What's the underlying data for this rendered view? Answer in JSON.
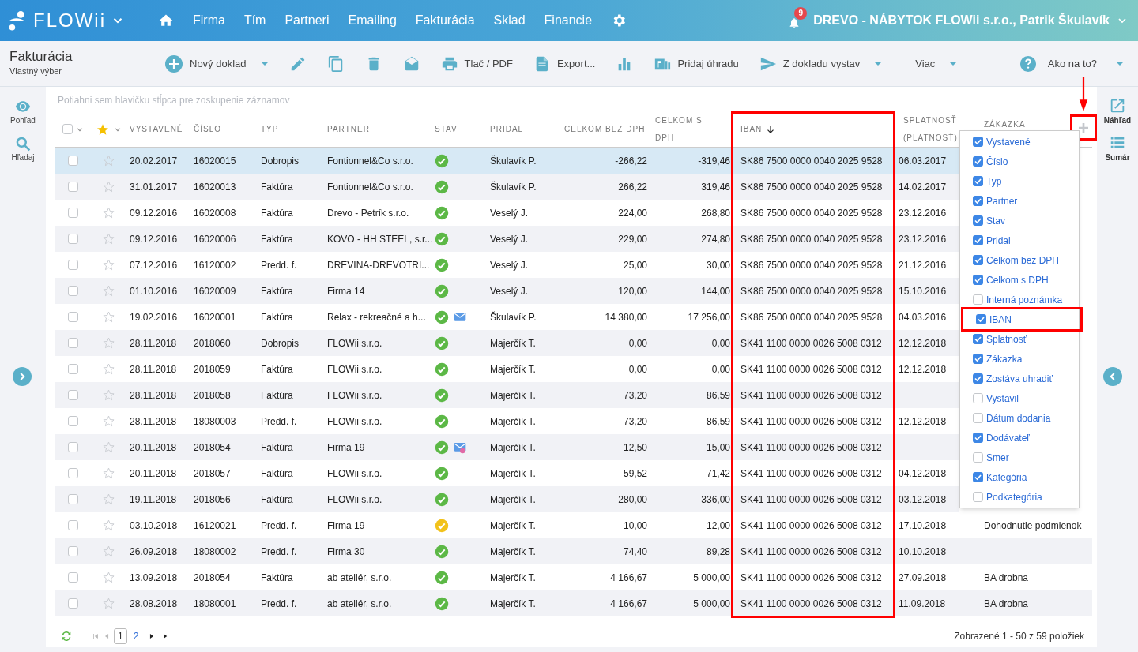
{
  "brand": {
    "name": "FLOWii"
  },
  "nav": [
    "Firma",
    "Tím",
    "Partneri",
    "Emailing",
    "Fakturácia",
    "Sklad",
    "Financie"
  ],
  "notifications": "9",
  "account": "DREVO - NÁBYTOK FLOWii s.r.o., Patrik Škulavík",
  "page": {
    "title": "Fakturácia",
    "subtitle": "Vlastný výber"
  },
  "toolbar": [
    {
      "kind": "plus",
      "label": "Nový doklad",
      "dropdown": true
    },
    {
      "kind": "pencil"
    },
    {
      "kind": "copy"
    },
    {
      "kind": "trash"
    },
    {
      "kind": "mail"
    },
    {
      "kind": "print",
      "label": "Tlač / PDF"
    },
    {
      "kind": "xls",
      "label": "Export..."
    },
    {
      "kind": "chart"
    },
    {
      "kind": "pay",
      "label": "Pridaj úhradu"
    },
    {
      "kind": "send",
      "label": "Z dokladu vystav",
      "dropdown": true
    },
    {
      "kind": "none",
      "label": "Viac",
      "dropdown": true
    }
  ],
  "help": {
    "label": "Ako na to?"
  },
  "left_tools": [
    "Pohľad",
    "Hľadaj"
  ],
  "right_tools": [
    "Náhľad",
    "Sumár"
  ],
  "group_hint": "Potiahni sem hlavičku stĺpca pre zoskupenie záznamov",
  "select_all": {
    "checked": false
  },
  "columns": [
    {
      "label": "VYSTAVENÉ"
    },
    {
      "label": "ČÍSLO"
    },
    {
      "label": "TYP"
    },
    {
      "label": "PARTNER"
    },
    {
      "label": "STAV"
    },
    {
      "label": "PRIDAL"
    },
    {
      "label": "CELKOM BEZ DPH"
    },
    {
      "label": "CELKOM S DPH"
    },
    {
      "label": "IBAN",
      "sorted": true,
      "highlighted": true
    },
    {
      "label": "SPLATNOSŤ (PLATNOSŤ)"
    },
    {
      "label": "ZÁKAZKA"
    }
  ],
  "rows": [
    {
      "selected": true,
      "cells": [
        "20.02.2017",
        "16020015",
        "Dobropis",
        "Fontionnel&Co s.r.o.",
        "Škulavík P.",
        "-266,22",
        "-319,46",
        "SK86 7500 0000 0040 2025 9528",
        "06.03.2017"
      ],
      "color": "#5cb846",
      "email": false,
      "email_error": false
    },
    {
      "selected": false,
      "cells": [
        "31.01.2017",
        "16020013",
        "Faktúra",
        "Fontionnel&Co s.r.o.",
        "Škulavík P.",
        "266,22",
        "319,46",
        "SK86 7500 0000 0040 2025 9528",
        "14.02.2017"
      ],
      "color": "#5cb846",
      "email": false,
      "email_error": false
    },
    {
      "selected": false,
      "cells": [
        "09.12.2016",
        "16020008",
        "Faktúra",
        "Drevo - Petrík s.r.o.",
        "Veselý J.",
        "224,00",
        "268,80",
        "SK86 7500 0000 0040 2025 9528",
        "23.12.2016"
      ],
      "color": "#5cb846",
      "email": false,
      "email_error": false
    },
    {
      "selected": false,
      "cells": [
        "09.12.2016",
        "16020006",
        "Faktúra",
        "KOVO - HH STEEL, s.r...",
        "Veselý J.",
        "229,00",
        "274,80",
        "SK86 7500 0000 0040 2025 9528",
        "23.12.2016"
      ],
      "color": "#5cb846",
      "email": false,
      "email_error": false
    },
    {
      "selected": false,
      "cells": [
        "07.12.2016",
        "16120002",
        "Predd. f.",
        "DREVINA-DREVOTRI...",
        "Veselý J.",
        "25,00",
        "30,00",
        "SK86 7500 0000 0040 2025 9528",
        "21.12.2016"
      ],
      "color": "#5cb846",
      "email": false,
      "email_error": false
    },
    {
      "selected": false,
      "cells": [
        "01.10.2016",
        "16020009",
        "Faktúra",
        "Firma 14",
        "Veselý J.",
        "120,00",
        "144,00",
        "SK86 7500 0000 0040 2025 9528",
        "15.10.2016"
      ],
      "color": "#5cb846",
      "email": false,
      "email_error": false
    },
    {
      "selected": false,
      "cells": [
        "19.02.2016",
        "16020001",
        "Faktúra",
        "Relax - rekreačné a h...",
        "Škulavík P.",
        "14 380,00",
        "17 256,00",
        "SK86 7500 0000 0040 2025 9528",
        "04.03.2016"
      ],
      "color": "#5cb846",
      "email": true,
      "email_error": false
    },
    {
      "selected": false,
      "cells": [
        "28.11.2018",
        "2018060",
        "Dobropis",
        "FLOWii s.r.o.",
        "Majerčík T.",
        "0,00",
        "0,00",
        "SK41 1100 0000 0026 5008 0312",
        "12.12.2018"
      ],
      "color": "#5cb846",
      "email": false,
      "email_error": false
    },
    {
      "selected": false,
      "cells": [
        "28.11.2018",
        "2018059",
        "Faktúra",
        "FLOWii s.r.o.",
        "Majerčík T.",
        "0,00",
        "0,00",
        "SK41 1100 0000 0026 5008 0312",
        "12.12.2018"
      ],
      "color": "#5cb846",
      "email": false,
      "email_error": false
    },
    {
      "selected": false,
      "cells": [
        "28.11.2018",
        "2018058",
        "Faktúra",
        "FLOWii s.r.o.",
        "Majerčík T.",
        "73,20",
        "86,59",
        "SK41 1100 0000 0026 5008 0312"
      ],
      "color": "#5cb846",
      "email": false,
      "email_error": false
    },
    {
      "selected": false,
      "cells": [
        "28.11.2018",
        "18080003",
        "Predd. f.",
        "FLOWii s.r.o.",
        "Majerčík T.",
        "73,20",
        "86,59",
        "SK41 1100 0000 0026 5008 0312",
        "12.12.2018"
      ],
      "color": "#5cb846",
      "email": false,
      "email_error": false
    },
    {
      "selected": false,
      "cells": [
        "20.11.2018",
        "2018054",
        "Faktúra",
        "Firma 19",
        "Majerčík T.",
        "12,50",
        "15,00",
        "SK41 1100 0000 0026 5008 0312"
      ],
      "color": "#5cb846",
      "email": true,
      "email_error": true
    },
    {
      "selected": false,
      "cells": [
        "20.11.2018",
        "2018057",
        "Faktúra",
        "FLOWii s.r.o.",
        "Majerčík T.",
        "59,52",
        "71,42",
        "SK41 1100 0000 0026 5008 0312",
        "04.12.2018"
      ],
      "color": "#5cb846",
      "email": false,
      "email_error": false
    },
    {
      "selected": false,
      "cells": [
        "19.11.2018",
        "2018056",
        "Faktúra",
        "FLOWii s.r.o.",
        "Majerčík T.",
        "280,00",
        "336,00",
        "SK41 1100 0000 0026 5008 0312",
        "03.12.2018"
      ],
      "color": "#5cb846",
      "email": false,
      "email_error": false
    },
    {
      "selected": false,
      "cells": [
        "03.10.2018",
        "16120021",
        "Predd. f.",
        "Firma 19",
        "Majerčík T.",
        "10,00",
        "12,00",
        "SK41 1100 0000 0026 5008 0312",
        "17.10.2018",
        "Dohodnutie podmienok"
      ],
      "color": "#f2c21b",
      "email": false,
      "email_error": false
    },
    {
      "selected": false,
      "cells": [
        "26.09.2018",
        "18080002",
        "Predd. f.",
        "Firma 30",
        "Majerčík T.",
        "74,40",
        "89,28",
        "SK41 1100 0000 0026 5008 0312",
        "10.10.2018"
      ],
      "color": "#5cb846",
      "email": false,
      "email_error": false
    },
    {
      "selected": false,
      "cells": [
        "13.09.2018",
        "2018054",
        "Faktúra",
        "ab ateliér, s.r.o.",
        "Majerčík T.",
        "4 166,67",
        "5 000,00",
        "SK41 1100 0000 0026 5008 0312",
        "27.09.2018",
        "BA drobna"
      ],
      "color": "#5cb846",
      "email": false,
      "email_error": false
    },
    {
      "selected": false,
      "cells": [
        "28.08.2018",
        "18080001",
        "Predd. f.",
        "ab ateliér, s.r.o.",
        "Majerčík T.",
        "4 166,67",
        "5 000,00",
        "SK41 1100 0000 0026 5008 0312",
        "11.09.2018",
        "BA drobna"
      ],
      "color": "#5cb846",
      "email": false,
      "email_error": false
    }
  ],
  "column_menu": {
    "highlighted": true,
    "items": [
      {
        "label": "Vystavené",
        "checked": true
      },
      {
        "label": "Číslo",
        "checked": true
      },
      {
        "label": "Typ",
        "checked": true
      },
      {
        "label": "Partner",
        "checked": true
      },
      {
        "label": "Stav",
        "checked": true
      },
      {
        "label": "Pridal",
        "checked": true
      },
      {
        "label": "Celkom bez DPH",
        "checked": true
      },
      {
        "label": "Celkom s DPH",
        "checked": true
      },
      {
        "label": "Interná poznámka",
        "checked": false
      },
      {
        "label": "IBAN",
        "checked": true,
        "highlighted": true
      },
      {
        "label": "Splatnosť",
        "checked": true
      },
      {
        "label": "Zákazka",
        "checked": true
      },
      {
        "label": "Zostáva uhradiť",
        "checked": true
      },
      {
        "label": "Vystavil",
        "checked": false
      },
      {
        "label": "Dátum dodania",
        "checked": false
      },
      {
        "label": "Dodávateľ",
        "checked": true
      },
      {
        "label": "Smer",
        "checked": false
      },
      {
        "label": "Kategória",
        "checked": true
      },
      {
        "label": "Podkategória",
        "checked": false
      }
    ]
  },
  "pager": {
    "pages": [
      {
        "label": "1",
        "selected": true
      },
      {
        "label": "2",
        "selected": false
      }
    ],
    "summary": "Zobrazené 1 - 50 z 59 položiek"
  }
}
